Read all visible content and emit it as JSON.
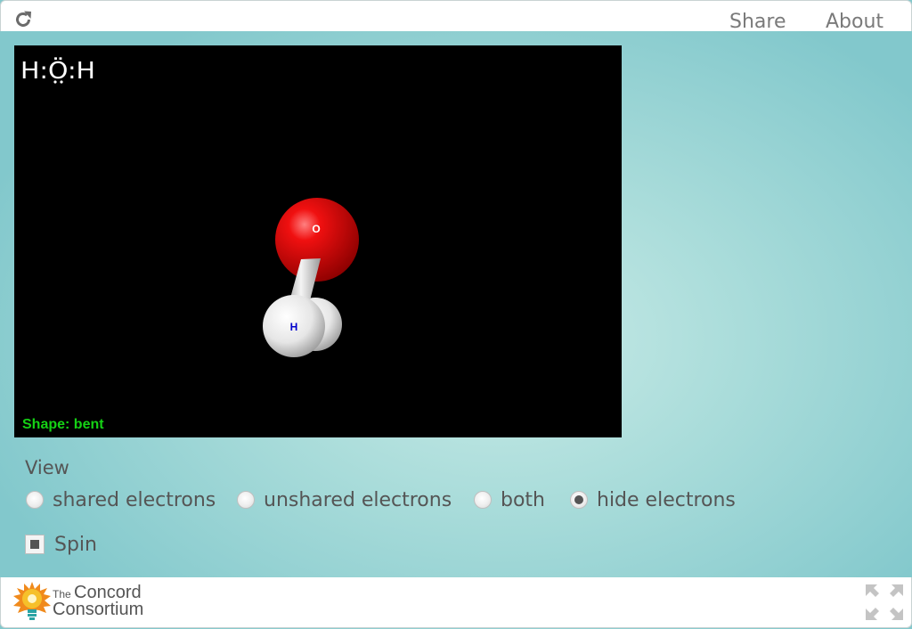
{
  "header": {
    "share_label": "Share",
    "about_label": "About"
  },
  "viewer": {
    "formula": "H:Ö:H",
    "shape_label": "Shape: bent",
    "atoms": [
      "O",
      "H"
    ]
  },
  "controls": {
    "view_title": "View",
    "options": [
      {
        "label": "shared electrons",
        "selected": false
      },
      {
        "label": "unshared electrons",
        "selected": false
      },
      {
        "label": "both",
        "selected": false
      },
      {
        "label": "hide electrons",
        "selected": true
      }
    ],
    "spin_label": "Spin",
    "spin_checked": true
  },
  "footer": {
    "logo_the": "The",
    "logo_concord": "Concord",
    "logo_consortium": "Consortium"
  },
  "colors": {
    "oxygen": "#e60000",
    "hydrogen": "#f0f0f0",
    "shape_text": "#15d215",
    "hydrogen_label": "#0000cc"
  }
}
